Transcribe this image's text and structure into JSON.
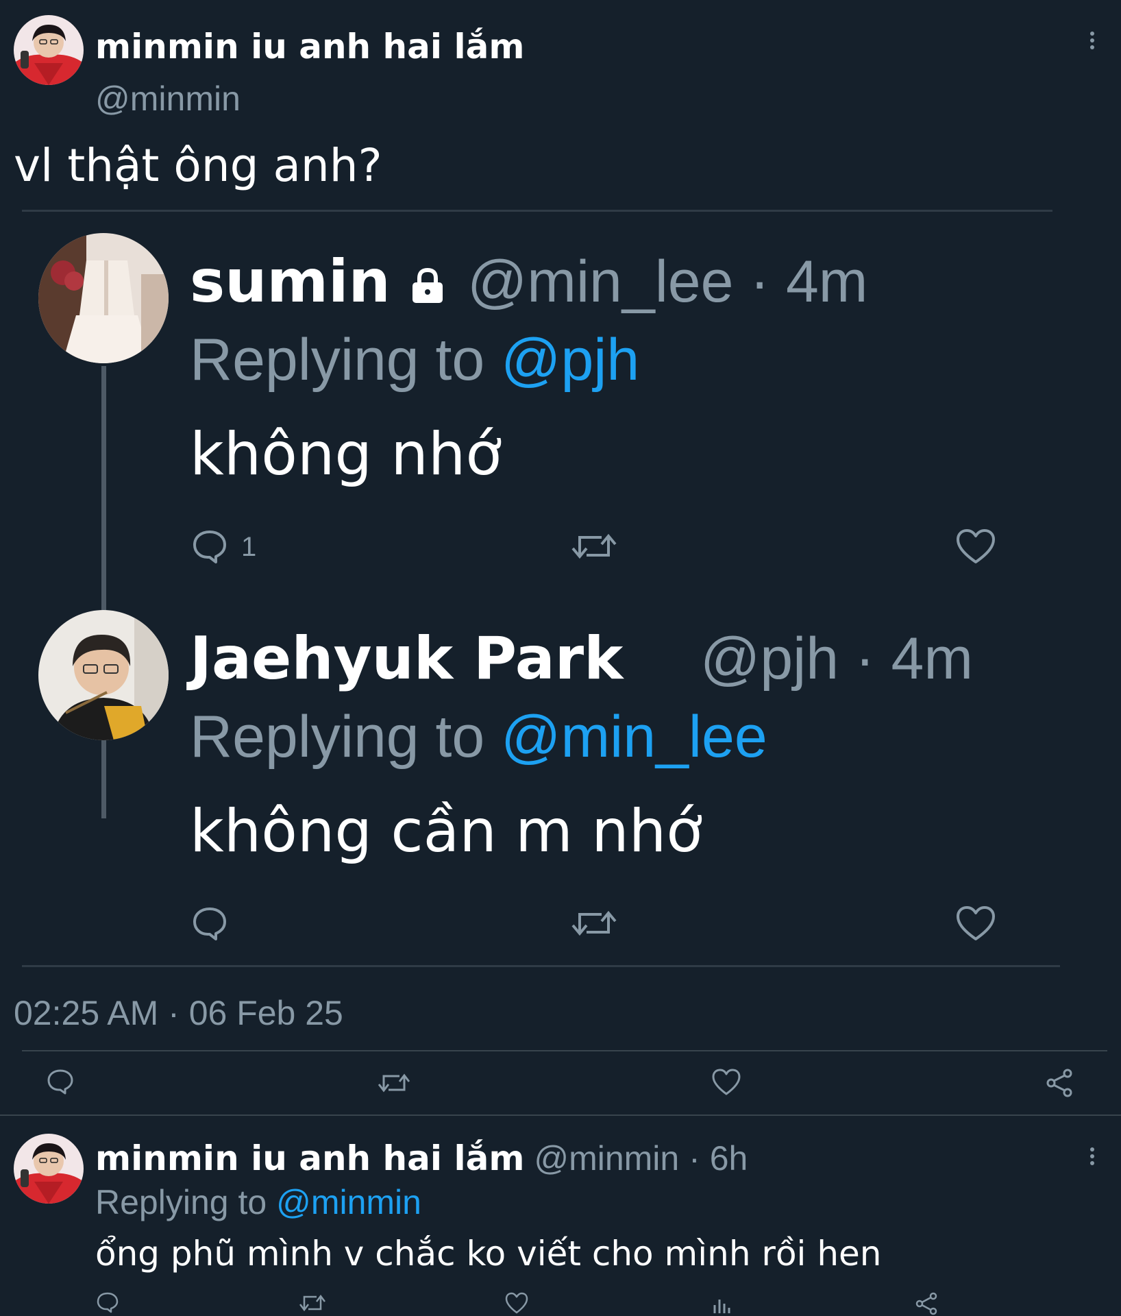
{
  "main_tweet": {
    "author_name": "minmin iu anh hai lắm",
    "author_handle": "@minmin",
    "text": "vl thật ông anh?",
    "timestamp": "02:25 AM · 06 Feb 25",
    "more_icon": "more-vertical-icon"
  },
  "screenshot": {
    "tweet1": {
      "name": "sumin",
      "lock_icon": "lock-icon",
      "handle": "@min_lee",
      "sep": "·",
      "time": "4m",
      "replying_prefix": "Replying to",
      "replying_handle": "@pjh",
      "text": "không nhớ",
      "reply_count": "1"
    },
    "tweet2": {
      "name": "Jaehyuk Park",
      "handle": "@pjh",
      "sep": "·",
      "time": "4m",
      "replying_prefix": "Replying to",
      "replying_handle": "@min_lee",
      "text": "không cần m nhớ"
    }
  },
  "action_bar": {
    "icons": [
      "reply-icon",
      "retweet-icon",
      "like-icon",
      "share-icon"
    ]
  },
  "reply_tweet": {
    "author_name": "minmin iu anh hai lắm",
    "author_handle": "@minmin",
    "sep": "·",
    "time": "6h",
    "replying_prefix": "Replying to",
    "replying_handle": "@minmin",
    "text": "ổng phũ mình v chắc ko viết cho mình rồi hen",
    "more_icon": "more-vertical-icon",
    "icons": [
      "reply-icon",
      "retweet-icon",
      "like-icon",
      "analytics-icon",
      "share-icon"
    ]
  },
  "colors": {
    "background": "#15202b",
    "muted": "#8899a6",
    "accent": "#1da1f2",
    "divider": "#38444d"
  }
}
